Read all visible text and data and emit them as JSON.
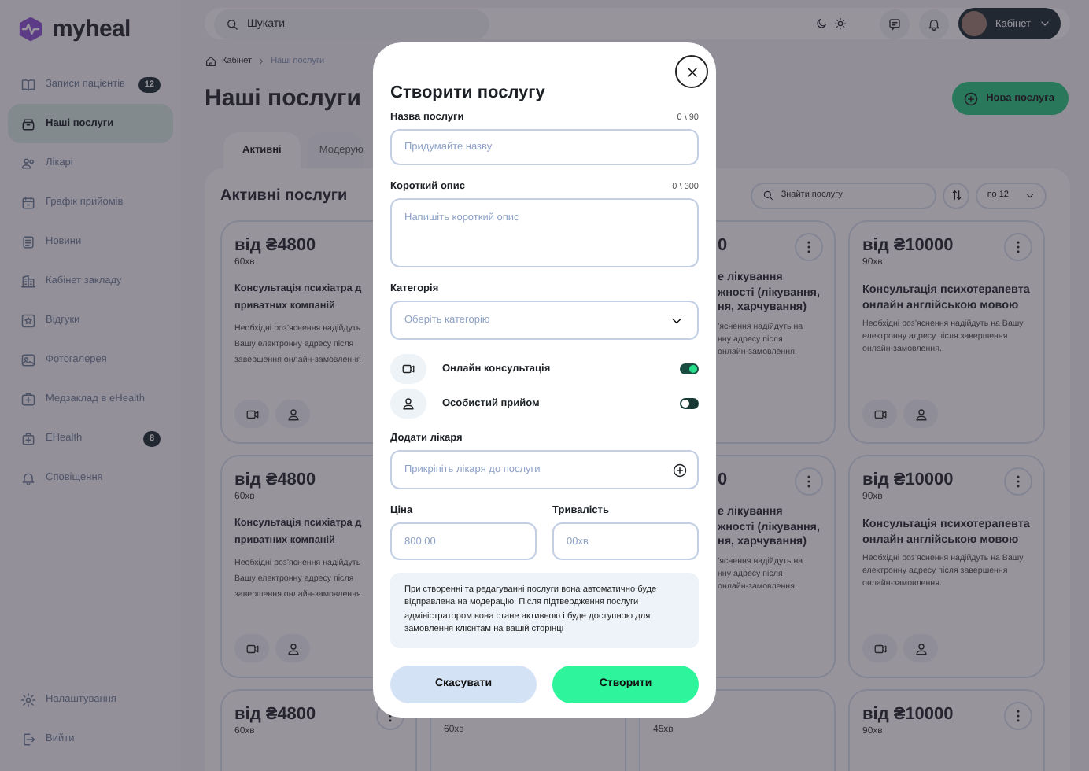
{
  "sidebar": {
    "logo": "myheal",
    "items": [
      {
        "label": "Записи пацієнтів",
        "badge": "12",
        "selected": false
      },
      {
        "label": "Наші послуги",
        "selected": true
      },
      {
        "label": "Лікарі",
        "selected": false
      },
      {
        "label": "Графік прийомів",
        "selected": false
      },
      {
        "label": "Новини",
        "selected": false
      },
      {
        "label": "Кабінет закладу",
        "selected": false
      },
      {
        "label": "Відгуки",
        "selected": false
      },
      {
        "label": "Фотогалерея",
        "selected": false
      },
      {
        "label": "Медзаклад в eHealth",
        "selected": false
      },
      {
        "label": "EHealth",
        "badge": "8",
        "selected": false
      },
      {
        "label": "Сповіщення",
        "selected": false
      }
    ],
    "bottom_items": [
      {
        "label": "Налаштування"
      },
      {
        "label": "Вийти"
      }
    ]
  },
  "topbar": {
    "search": {
      "placeholder": "Шукати"
    },
    "profile": {
      "label": "Кабінет"
    }
  },
  "breadcrumb": [
    {
      "label": "Кабінет",
      "current": false
    },
    {
      "label": "Наші послуги",
      "current": true
    }
  ],
  "page_title": "Наші послуги",
  "new_button": "Нова послуга",
  "tabs": [
    {
      "label": "Активні",
      "selected": true
    },
    {
      "label": "Модерую",
      "selected": false
    }
  ],
  "panel": {
    "title": "Активні послуги",
    "search": {
      "placeholder": "Знайти послугу"
    },
    "page_size": "по 12",
    "rows": [
      {
        "cards": [
          {
            "kind": "left_part",
            "price": "від ₴4800",
            "duration": "60хв",
            "title_lines": [
              "Консультація психіатра д",
              "приватних компаній"
            ],
            "description_lines": [
              "Необхідні роз’яснення надійдуть",
              "Вашу електронну адресу після",
              "завершення онлайн-замовлення"
            ]
          },
          {
            "kind": "right_part",
            "price": "0",
            "title_lines": [
              "е лікування",
              "жності (лікування,",
              "ня, харчування)"
            ],
            "description_lines": [
              "’яснення надійдуть на",
              "нну адресу після",
              "онлайн-замовлення."
            ]
          },
          {
            "kind": "full",
            "price": "від ₴10000",
            "duration": "90хв",
            "title": "Консультація психотерапевта онлайн англійською мовою",
            "description": "Необхідні роз’яснення надійдуть на Вашу електронну адресу після завершення онлайн-замовлення."
          }
        ]
      },
      {
        "cards": [
          {
            "kind": "left_part",
            "price": "від ₴4800",
            "duration": "60хв",
            "title_lines": [
              "Консультація психіатра д",
              "приватних компаній"
            ],
            "description_lines": [
              "Необхідні роз’яснення надійдуть",
              "Вашу електронну адресу після",
              "завершення онлайн-замовлення"
            ]
          },
          {
            "kind": "right_part",
            "price": "0",
            "title_lines": [
              "е лікування",
              "жності (лікування,",
              "ня, харчування)"
            ],
            "description_lines": [
              "’яснення надійдуть на",
              "нну адресу після",
              "онлайн-замовлення."
            ]
          },
          {
            "kind": "full",
            "price": "від ₴10000",
            "duration": "90хв",
            "title": "Консультація психотерапевта онлайн англійською мовою",
            "description": "Необхідні роз’яснення надійдуть на Вашу електронну адресу після завершення онлайн-замовлення."
          }
        ]
      },
      {
        "cards": [
          {
            "kind": "full",
            "price": "від ₴4800",
            "duration": "60хв"
          },
          {
            "kind": "bottom_part",
            "duration": "60хв"
          },
          {
            "kind": "bottom_part",
            "duration": "45хв"
          },
          {
            "kind": "full",
            "price": "від ₴10000",
            "duration": "90хв"
          }
        ]
      }
    ]
  },
  "modal": {
    "title": "Створити послугу",
    "name_field": {
      "label": "Назва послуги",
      "counter": "0 \\ 90",
      "placeholder": "Придумайте назву"
    },
    "description_field": {
      "label": "Короткий опис",
      "counter": "0 \\ 300",
      "placeholder": "Напишіть короткий опис"
    },
    "category_field": {
      "label": "Категорія",
      "placeholder": "Оберіть категорію"
    },
    "toggles": [
      {
        "label": "Онлайн консультація",
        "on": true
      },
      {
        "label": "Особистий прийом",
        "on": false
      }
    ],
    "doctor_field": {
      "label": "Додати лікаря",
      "placeholder": "Прикріпіть лікаря до послуги"
    },
    "price_field": {
      "label": "Ціна",
      "placeholder": "800.00"
    },
    "duration_field": {
      "label": "Тривалість",
      "placeholder": "00хв"
    },
    "note": "При створенні та редагуванні послуги вона автоматично буде відправлена на модерацію. Після підтвердження послуги адміністратором вона стане активною і буде доступною для замовлення клієнтам на вашій сторінці",
    "buttons": [
      {
        "kind": "secondary",
        "label": "Скасувати"
      },
      {
        "kind": "primary",
        "label": "Створити"
      }
    ]
  }
}
